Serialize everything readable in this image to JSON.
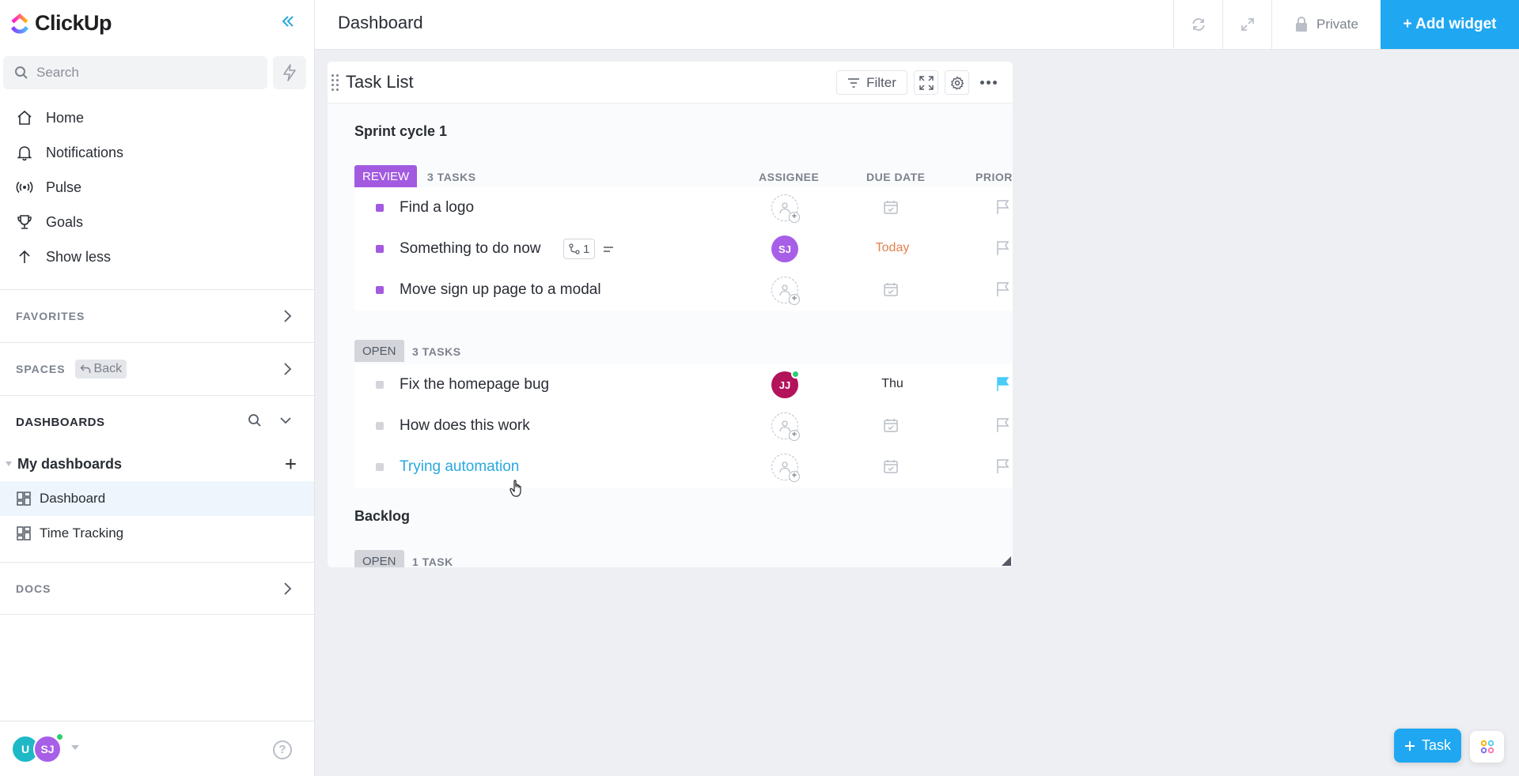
{
  "app": {
    "name": "ClickUp"
  },
  "sidebar": {
    "search_placeholder": "Search",
    "nav": [
      {
        "label": "Home",
        "icon": "home-icon"
      },
      {
        "label": "Notifications",
        "icon": "bell-icon"
      },
      {
        "label": "Pulse",
        "icon": "pulse-icon"
      },
      {
        "label": "Goals",
        "icon": "trophy-icon"
      },
      {
        "label": "Show less",
        "icon": "arrow-up-icon"
      }
    ],
    "favorites_label": "FAVORITES",
    "spaces_label": "SPACES",
    "spaces_back_label": "Back",
    "dashboards_label": "DASHBOARDS",
    "my_dashboards_label": "My dashboards",
    "dashboards": [
      {
        "label": "Dashboard",
        "active": true
      },
      {
        "label": "Time Tracking",
        "active": false
      }
    ],
    "docs_label": "DOCS",
    "user_avatars": [
      "U",
      "SJ"
    ]
  },
  "header": {
    "title": "Dashboard",
    "private_label": "Private",
    "add_widget_label": "+ Add widget"
  },
  "widget": {
    "title": "Task List",
    "filter_label": "Filter",
    "columns": {
      "assignee": "ASSIGNEE",
      "due_date": "DUE DATE",
      "priority": "PRIOR"
    },
    "groups": [
      {
        "title": "Sprint cycle 1",
        "statuses": [
          {
            "status": "REVIEW",
            "count": "3 TASKS",
            "tasks": [
              {
                "name": "Find a logo",
                "assignee": "",
                "due": ""
              },
              {
                "name": "Something to do now",
                "subtasks": "1",
                "assignee": "SJ",
                "due": "Today"
              },
              {
                "name": "Move sign up page to a modal",
                "assignee": "",
                "due": ""
              }
            ]
          },
          {
            "status": "OPEN",
            "count": "3 TASKS",
            "tasks": [
              {
                "name": "Fix the homepage bug",
                "assignee": "JJ",
                "due": "Thu",
                "priority_color": "#49ccf9"
              },
              {
                "name": "How does this work",
                "assignee": "",
                "due": ""
              },
              {
                "name": "Trying automation",
                "assignee": "",
                "due": ""
              }
            ]
          }
        ]
      },
      {
        "title": "Backlog",
        "statuses": [
          {
            "status": "OPEN",
            "count": "1 TASK",
            "tasks": []
          }
        ]
      }
    ]
  },
  "floating": {
    "task_button_label": "Task"
  },
  "colors": {
    "accent": "#1fa7f2",
    "review": "#a25ae0",
    "open": "#d3d5da",
    "sj_avatar": "#a75fe8",
    "jj_avatar": "#b3135b",
    "u_avatar": "#1fb8c7",
    "today": "#e5804d"
  }
}
